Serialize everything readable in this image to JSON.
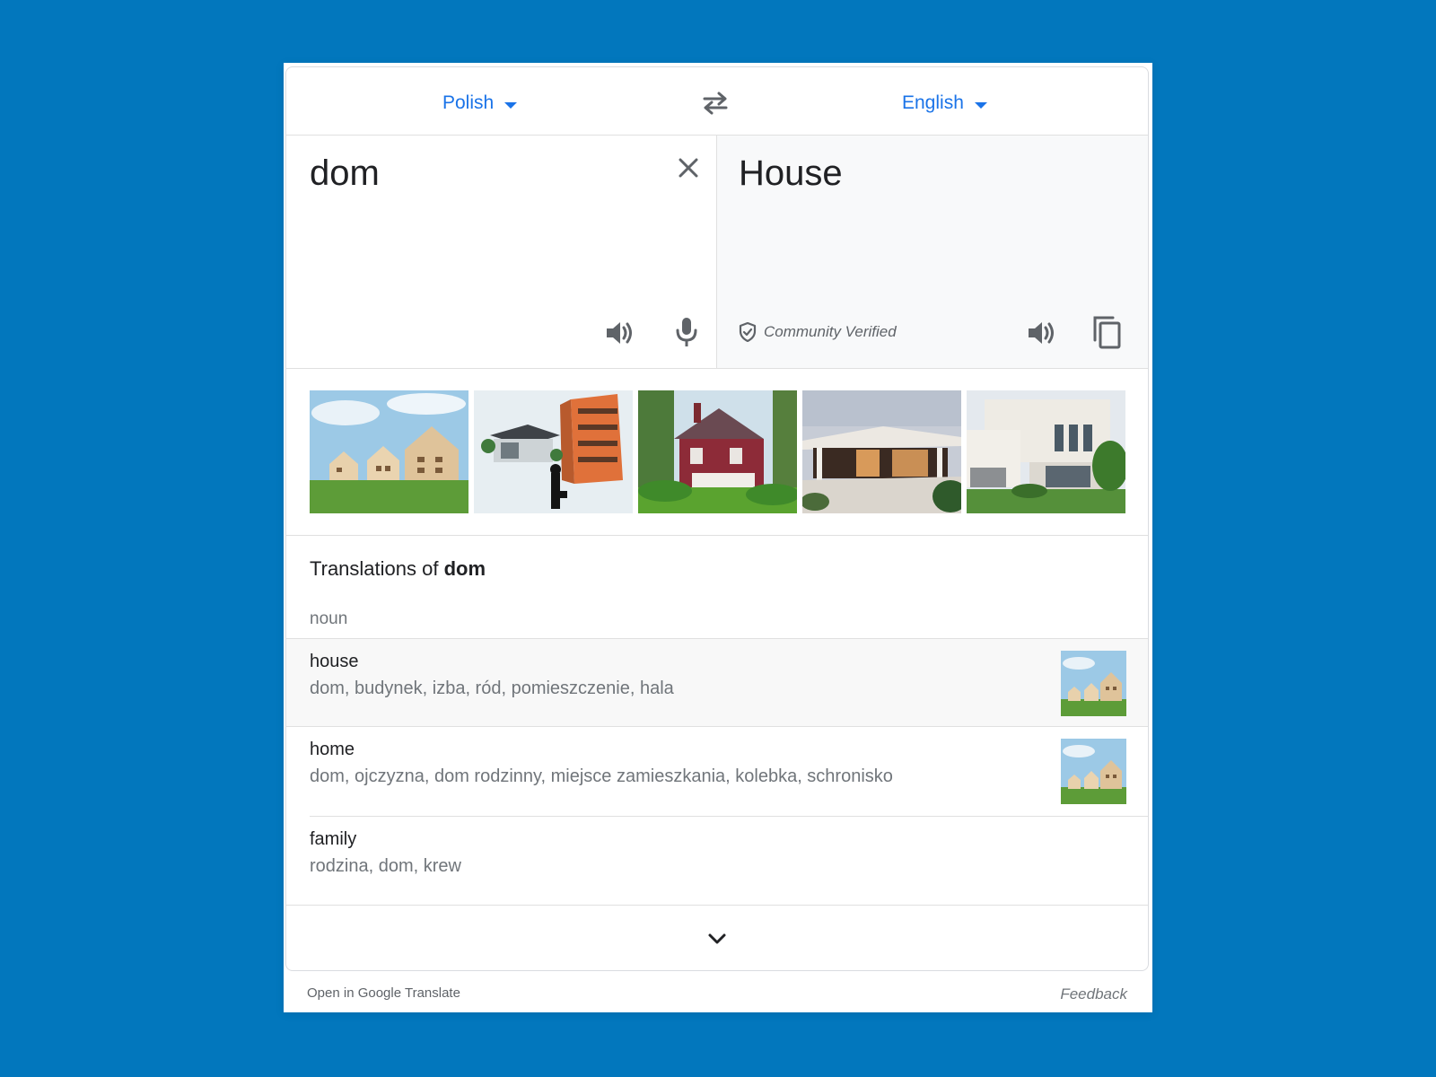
{
  "languages": {
    "source": "Polish",
    "target": "English"
  },
  "source_panel": {
    "text": "dom"
  },
  "target_panel": {
    "text": "House",
    "verified_label": "Community Verified"
  },
  "images": [
    "house-models-on-grass",
    "architect-model-buildings",
    "red-victorian-house",
    "modern-villa-patio",
    "white-modern-house"
  ],
  "translations": {
    "heading_prefix": "Translations of",
    "heading_word": "dom",
    "part_of_speech": "noun",
    "entries": [
      {
        "word": "house",
        "synonyms": "dom, budynek, izba, ród, pomieszczenie, hala"
      },
      {
        "word": "home",
        "synonyms": "dom, ojczyzna, dom rodzinny, miejsce zamieszkania, kolebka, schronisko"
      },
      {
        "word": "family",
        "synonyms": "rodzina, dom, krew"
      }
    ]
  },
  "footer": {
    "open_link": "Open in Google Translate",
    "feedback": "Feedback"
  },
  "colors": {
    "background": "#0277bd",
    "accent": "#1a73e8"
  },
  "icons": [
    "swap-icon",
    "close-icon",
    "speaker-icon",
    "mic-icon",
    "shield-check-icon",
    "copy-icon",
    "chevron-down-icon",
    "caret-down-icon"
  ]
}
